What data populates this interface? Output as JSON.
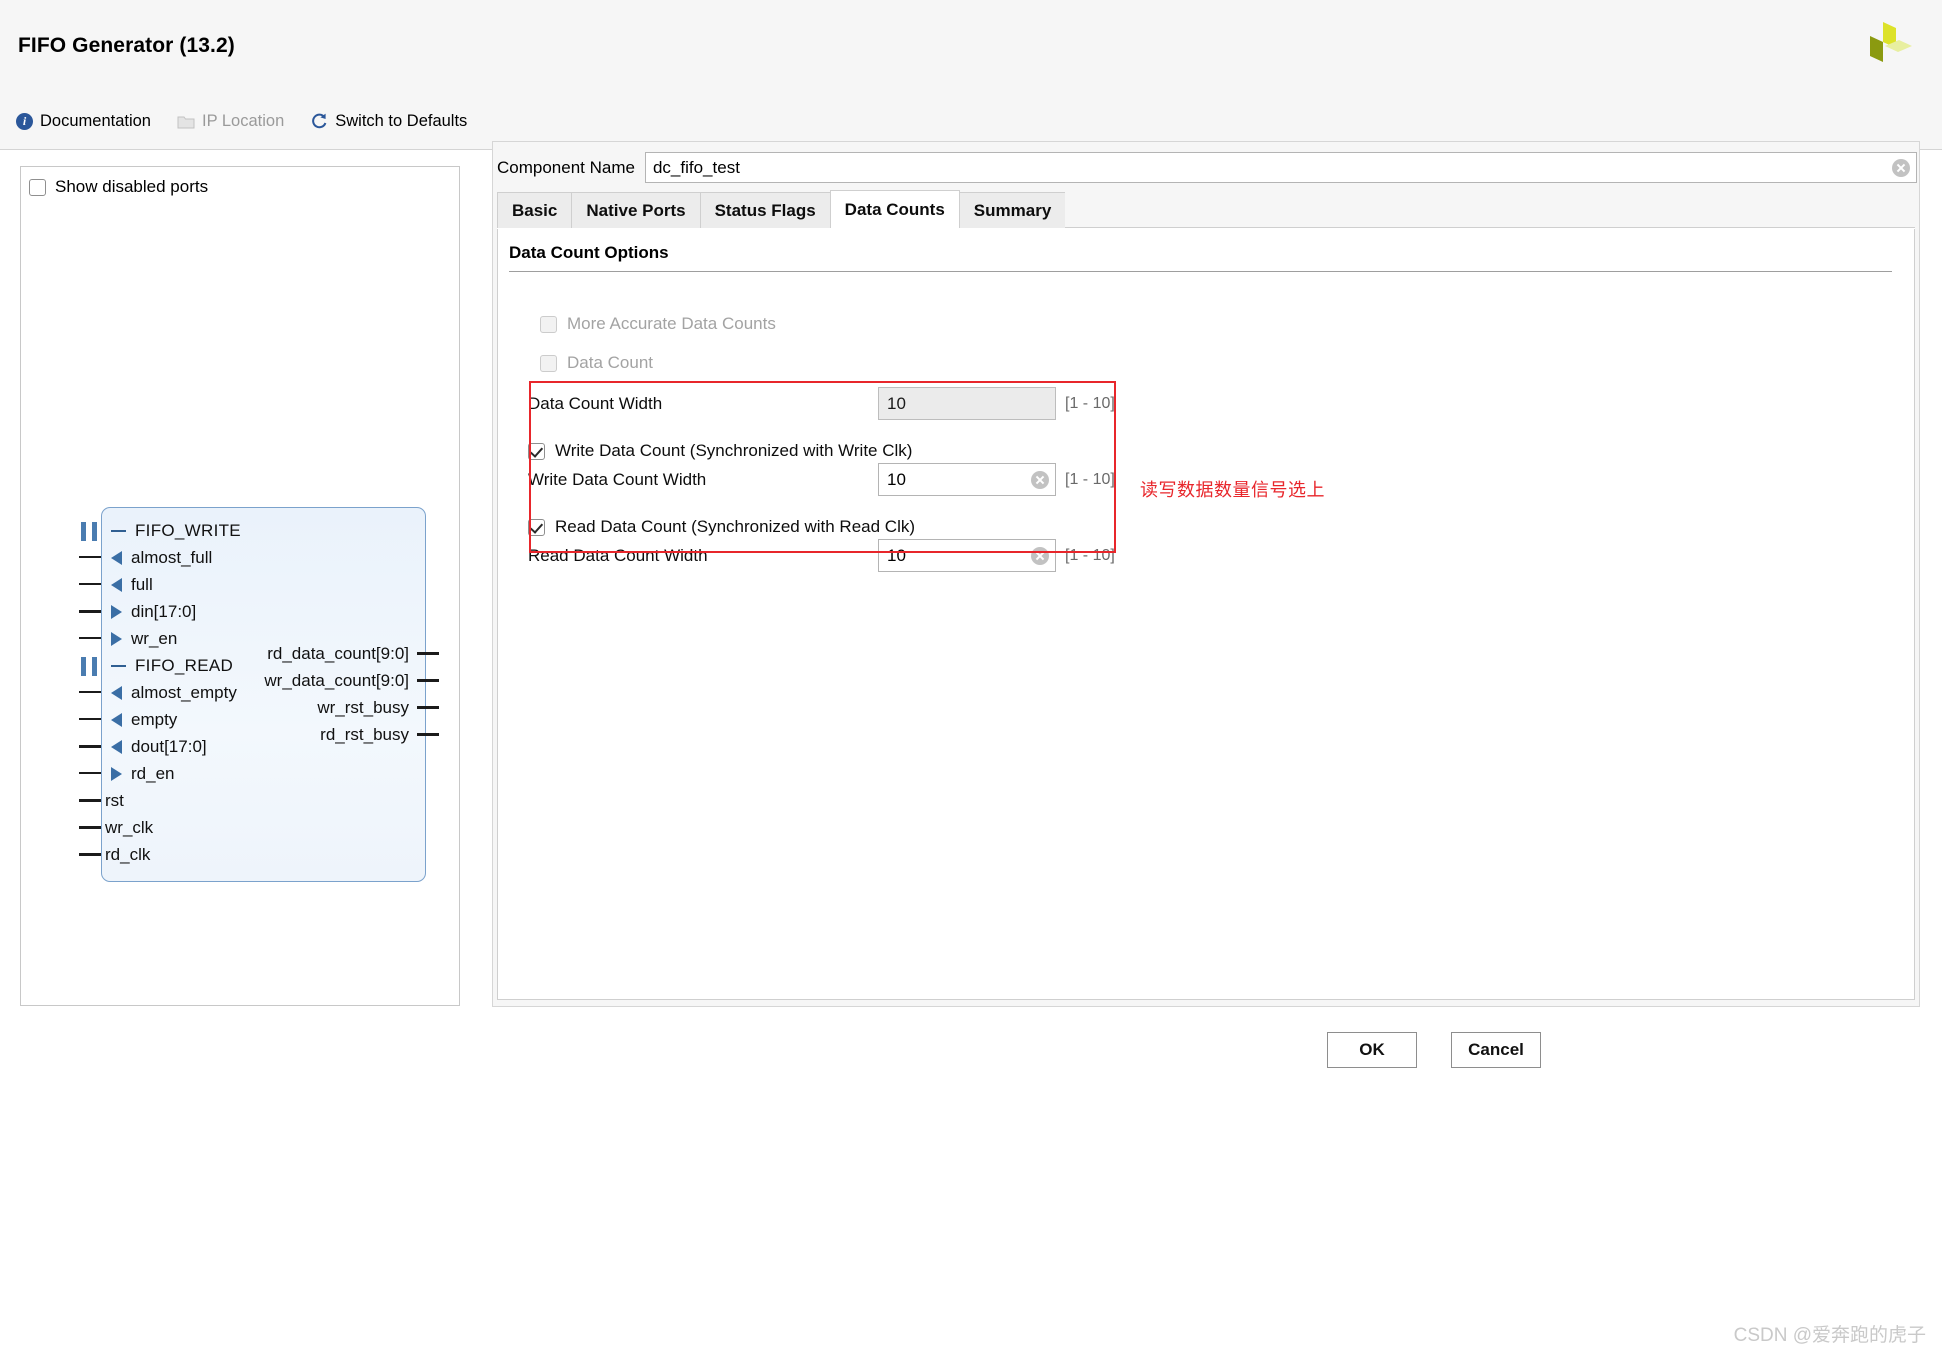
{
  "header": {
    "title": "FIFO Generator (13.2)",
    "logo_name": "xilinx-logo",
    "toolbar": [
      {
        "label": "Documentation",
        "icon": "info-icon",
        "disabled": false
      },
      {
        "label": "IP Location",
        "icon": "folder-icon",
        "disabled": true
      },
      {
        "label": "Switch to Defaults",
        "icon": "refresh-icon",
        "disabled": false
      }
    ]
  },
  "left_panel": {
    "show_disabled_ports": {
      "label": "Show disabled ports",
      "checked": false
    },
    "symbol": {
      "inputs": [
        {
          "label": "FIFO_WRITE",
          "marker": "group",
          "pin": "bus"
        },
        {
          "label": "almost_full",
          "marker": "out-arrow",
          "pin": "thin"
        },
        {
          "label": "full",
          "marker": "out-arrow",
          "pin": "thin"
        },
        {
          "label": "din[17:0]",
          "marker": "in-arrow",
          "pin": "thick"
        },
        {
          "label": "wr_en",
          "marker": "in-arrow",
          "pin": "thin"
        },
        {
          "label": "FIFO_READ",
          "marker": "group",
          "pin": "bus"
        },
        {
          "label": "almost_empty",
          "marker": "out-arrow",
          "pin": "thin"
        },
        {
          "label": "empty",
          "marker": "out-arrow",
          "pin": "thin"
        },
        {
          "label": "dout[17:0]",
          "marker": "out-arrow",
          "pin": "thick"
        },
        {
          "label": "rd_en",
          "marker": "in-arrow",
          "pin": "thin"
        },
        {
          "label": "rst",
          "marker": "none",
          "pin": "thick"
        },
        {
          "label": "wr_clk",
          "marker": "none",
          "pin": "thick"
        },
        {
          "label": "rd_clk",
          "marker": "none",
          "pin": "thick"
        }
      ],
      "outputs": [
        {
          "label": "rd_data_count[9:0]"
        },
        {
          "label": "wr_data_count[9:0]"
        },
        {
          "label": "wr_rst_busy"
        },
        {
          "label": "rd_rst_busy"
        }
      ]
    }
  },
  "right_panel": {
    "component_name": {
      "label": "Component Name",
      "value": "dc_fifo_test",
      "placeholder": ""
    },
    "tabs": [
      {
        "label": "Basic",
        "active": false
      },
      {
        "label": "Native Ports",
        "active": false
      },
      {
        "label": "Status Flags",
        "active": false
      },
      {
        "label": "Data Counts",
        "active": true
      },
      {
        "label": "Summary",
        "active": false
      }
    ],
    "data_count_options": {
      "section_title": "Data Count Options",
      "more_accurate": {
        "label": "More Accurate Data Counts",
        "checked": false,
        "enabled": false
      },
      "data_count": {
        "label": "Data Count",
        "checked": false,
        "enabled": false
      },
      "data_count_width": {
        "label": "Data Count Width",
        "value": "10",
        "range": "[1 - 10]",
        "enabled": false
      },
      "write_data_count": {
        "label": "Write Data Count (Synchronized with Write Clk)",
        "checked": true,
        "enabled": true
      },
      "write_data_count_width": {
        "label": "Write Data Count Width",
        "value": "10",
        "range": "[1 - 10]",
        "enabled": true
      },
      "read_data_count": {
        "label": "Read Data Count (Synchronized with Read Clk)",
        "checked": true,
        "enabled": true
      },
      "read_data_count_width": {
        "label": "Read Data Count Width",
        "value": "10",
        "range": "[1 - 10]",
        "enabled": true
      }
    },
    "annotation": "读写数据数量信号选上"
  },
  "footer": {
    "ok_label": "OK",
    "cancel_label": "Cancel"
  },
  "watermark": "CSDN @爱奔跑的虎子",
  "colors": {
    "accent_red": "#e8262b",
    "info_blue": "#2b579a",
    "symbol_fill": "#eef4fb",
    "symbol_border": "#7ba2cc",
    "arrow_blue": "#3a6ea5"
  }
}
